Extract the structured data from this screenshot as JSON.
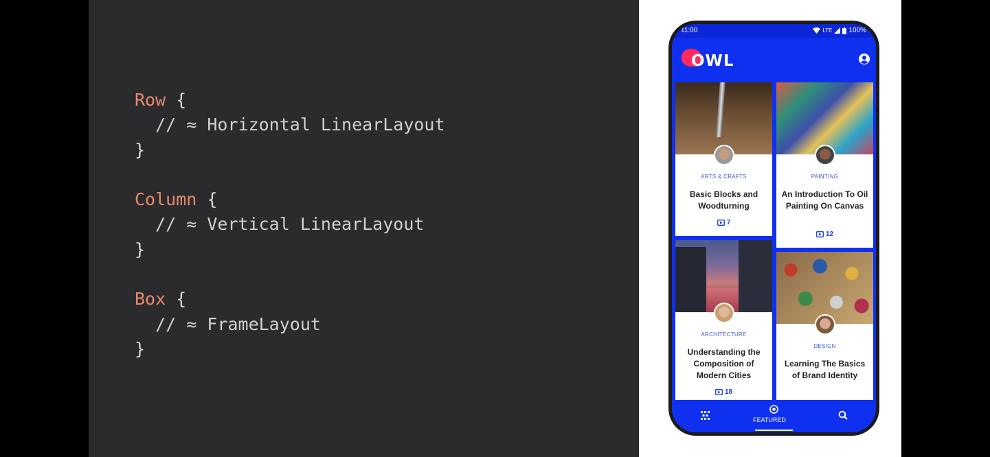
{
  "code": {
    "line1_kw": "Row",
    "line1_brace": " {",
    "line2": "  // ≈ Horizontal LinearLayout",
    "line3": "}",
    "line5_kw": "Column",
    "line5_brace": " {",
    "line6": "  // ≈ Vertical LinearLayout",
    "line7": "}",
    "line9_kw": "Box",
    "line9_brace": " {",
    "line10": "  // ≈ FrameLayout",
    "line11": "}"
  },
  "status": {
    "time": "11:00",
    "network": "LTE",
    "battery": "100%"
  },
  "app": {
    "name": "OWL",
    "accent": "#1030f0",
    "logo_color": "#ff2a5c"
  },
  "cards": [
    {
      "category": "ARTS & CRAFTS",
      "title": "Basic Blocks and Woodturning",
      "count": "7"
    },
    {
      "category": "PAINTING",
      "title": "An Introduction To Oil Painting On Canvas",
      "count": "12"
    },
    {
      "category": "ARCHITECTURE",
      "title": "Understanding the Composition of Modern Cities",
      "count": "18"
    },
    {
      "category": "DESIGN",
      "title": "Learning The Basics of Brand Identity"
    }
  ],
  "nav": {
    "featured_label": "FEATURED"
  },
  "icons": {
    "account": "account-circle-icon",
    "grid": "grid-icon",
    "featured": "featured-icon",
    "search": "search-icon",
    "count": "play-box-icon"
  }
}
